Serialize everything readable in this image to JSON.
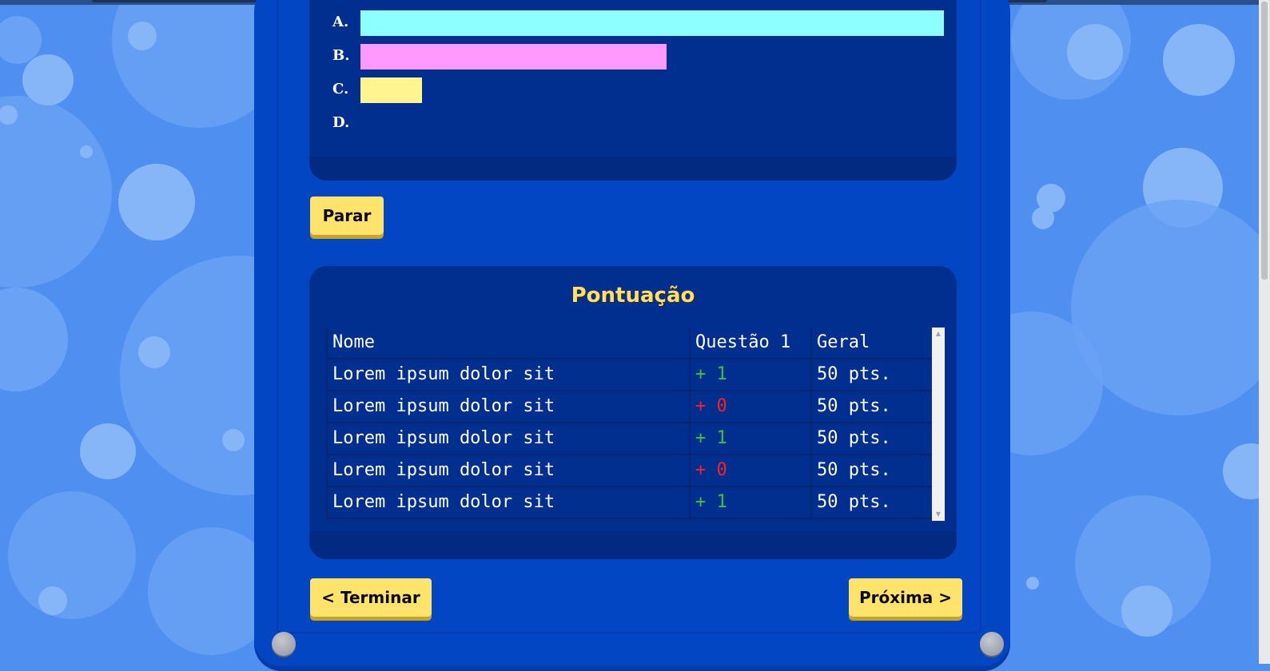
{
  "options": [
    {
      "label": "A.",
      "color": "#8effff",
      "fraction": 1.0
    },
    {
      "label": "B.",
      "color": "#ff99ff",
      "fraction": 0.525
    },
    {
      "label": "C.",
      "color": "#fff48e",
      "fraction": 0.105
    },
    {
      "label": "D.",
      "color": "#fffb8a",
      "fraction": 0.0
    }
  ],
  "buttons": {
    "stop": "Parar",
    "finish": "< Terminar",
    "next": "Próxima >"
  },
  "score": {
    "title": "Pontuação",
    "headers": {
      "name": "Nome",
      "question": "Questão 1",
      "total": "Geral"
    },
    "rows": [
      {
        "name": "Lorem ipsum dolor sit",
        "delta": "+ 1",
        "total": "50 pts.",
        "status": "positive"
      },
      {
        "name": "Lorem ipsum dolor sit",
        "delta": "+ 0",
        "total": "50 pts.",
        "status": "negative"
      },
      {
        "name": "Lorem ipsum dolor sit",
        "delta": "+ 1",
        "total": "50 pts.",
        "status": "positive"
      },
      {
        "name": "Lorem ipsum dolor sit",
        "delta": "+ 0",
        "total": "50 pts.",
        "status": "negative"
      },
      {
        "name": "Lorem ipsum dolor sit",
        "delta": "+ 1",
        "total": "50 pts.",
        "status": "positive"
      }
    ]
  },
  "colors": {
    "background": "#4f8ff0",
    "frame": "#0346c3",
    "panel": "#012f8f",
    "button": "#ffe36a",
    "title": "#ffdf6a",
    "positive": "#3ac23a",
    "negative": "#ff1f1f"
  }
}
